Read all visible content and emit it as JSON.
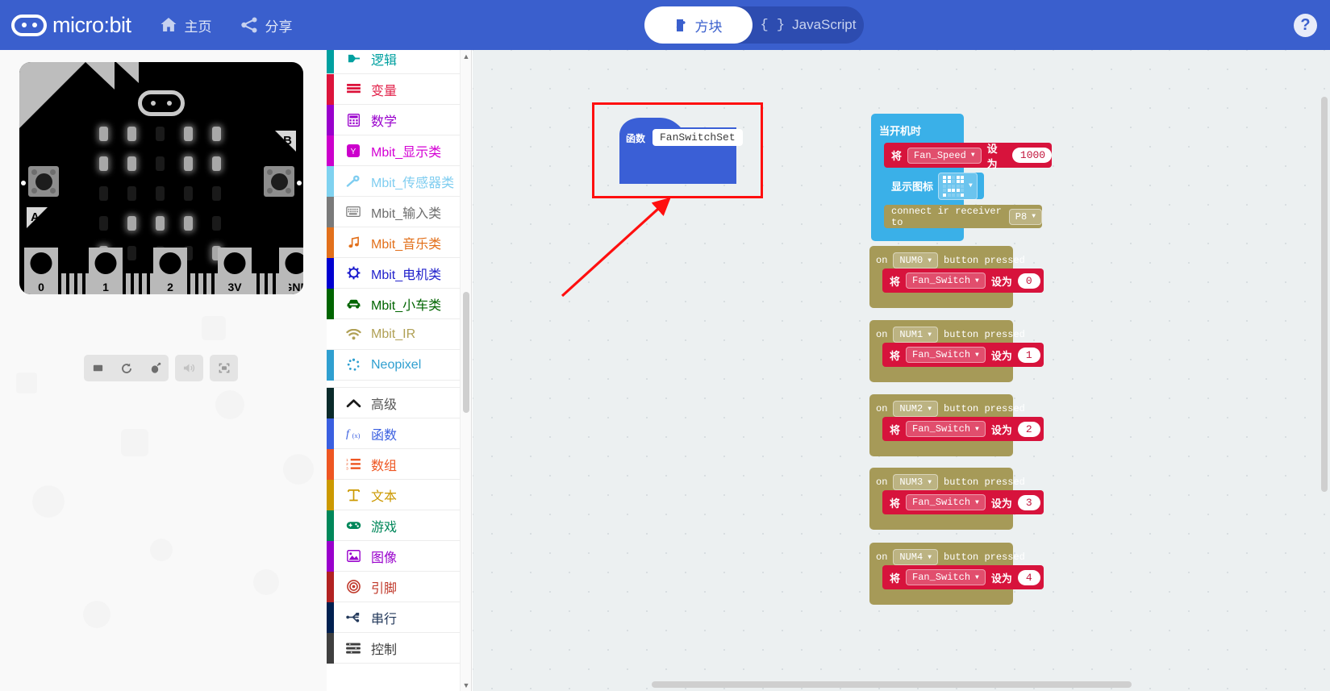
{
  "header": {
    "brand": "micro:bit",
    "home_label": "主页",
    "share_label": "分享",
    "home_icon": "home-icon",
    "share_icon": "share-icon",
    "help_icon": "question-mark-icon",
    "accent": "#3A5FCD",
    "tabs": [
      {
        "label": "方块",
        "icon": "puzzle-piece-icon",
        "active": true
      },
      {
        "label": "JavaScript",
        "icon": "curly-braces-icon",
        "active": false
      }
    ]
  },
  "simulator": {
    "board_name": "microbit-simulator",
    "button_a_label": "A",
    "button_b_label": "B",
    "pin_labels": [
      "0",
      "1",
      "2",
      "3V",
      "GND"
    ],
    "led_matrix": [
      [
        1,
        1,
        0,
        1,
        1
      ],
      [
        1,
        1,
        0,
        1,
        1
      ],
      [
        0,
        0,
        0,
        0,
        0
      ],
      [
        0,
        1,
        1,
        1,
        0
      ],
      [
        1,
        0,
        0,
        0,
        1
      ]
    ],
    "controls": [
      {
        "name": "stop-button",
        "icon": "stop-icon"
      },
      {
        "name": "restart-button",
        "icon": "restart-icon"
      },
      {
        "name": "debug-button",
        "icon": "bug-icon"
      },
      {
        "name": "mute-button",
        "icon": "speaker-icon"
      },
      {
        "name": "fullscreen-button",
        "icon": "fullscreen-icon"
      }
    ]
  },
  "toolbox": {
    "categories": [
      {
        "label": "逻辑",
        "color": "#00a0a0",
        "icon": "logic-icon",
        "text_color": "#00a0a0",
        "partial": true
      },
      {
        "label": "变量",
        "color": "#dc143c",
        "icon": "variables-icon",
        "text_color": "#e2234b"
      },
      {
        "label": "数学",
        "color": "#9900cc",
        "icon": "calculator-icon",
        "text_color": "#9900cc"
      },
      {
        "label": "Mbit_显示类",
        "color": "#cc00cc",
        "icon": "display-icon",
        "text_color": "#d400d4"
      },
      {
        "label": "Mbit_传感器类",
        "color": "#7fd2f0",
        "icon": "sensor-icon",
        "text_color": "#7fcdf0"
      },
      {
        "label": "Mbit_输入类",
        "color": "#7a7a7a",
        "icon": "keyboard-icon",
        "text_color": "#6e6e6e"
      },
      {
        "label": "Mbit_音乐类",
        "color": "#e2701b",
        "icon": "music-note-icon",
        "text_color": "#e2701b"
      },
      {
        "label": "Mbit_电机类",
        "color": "#0000d0",
        "icon": "gear-icon",
        "text_color": "#2222cc"
      },
      {
        "label": "Mbit_小车类",
        "color": "#006400",
        "icon": "car-icon",
        "text_color": "#006400"
      },
      {
        "label": "Mbit_IR",
        "color": "#b8a martin",
        "icon": "wifi-icon",
        "text_color": "#b0a055"
      },
      {
        "label": "Neopixel",
        "color": "#2f9fd0",
        "icon": "neopixel-icon",
        "text_color": "#2f9fd0"
      }
    ],
    "advanced": [
      {
        "label": "高级",
        "color": "#0a2a2a",
        "icon": "chevron-up-icon",
        "text_color": "#555555"
      },
      {
        "label": "函数",
        "color": "#3a5fe0",
        "icon": "function-icon",
        "text_color": "#3a5fe0"
      },
      {
        "label": "数组",
        "color": "#ee5622",
        "icon": "list-icon",
        "text_color": "#ee5622"
      },
      {
        "label": "文本",
        "color": "#cc9900",
        "icon": "text-icon",
        "text_color": "#cc9900"
      },
      {
        "label": "游戏",
        "color": "#00875a",
        "icon": "gamepad-icon",
        "text_color": "#00875a"
      },
      {
        "label": "图像",
        "color": "#9900cc",
        "icon": "image-icon",
        "text_color": "#9900cc"
      },
      {
        "label": "引脚",
        "color": "#b22222",
        "icon": "target-icon",
        "text_color": "#c0392b"
      },
      {
        "label": "串行",
        "color": "#002050",
        "icon": "usb-icon",
        "text_color": "#23395b"
      },
      {
        "label": "控制",
        "color": "#3f3f3f",
        "icon": "control-icon",
        "text_color": "#3f3f3f"
      }
    ],
    "scroll_up_icon": "chevron-up-icon",
    "scroll_down_icon": "chevron-down-icon"
  },
  "workspace": {
    "function_block": {
      "keyword": "函数",
      "name": "FanSwitchSet",
      "color": "#3a5fd6",
      "highlight_color": "#ff0f0f"
    },
    "annotation_arrow": {
      "name": "red-arrow",
      "color": "#ff0f0f"
    },
    "on_start": {
      "label": "当开机时",
      "color": "#3ab0e8",
      "statements": [
        {
          "type": "set-variable",
          "prefix": "将",
          "variable": "Fan_Speed",
          "middle": "设为",
          "value": "1000",
          "color": "#d7133c"
        },
        {
          "type": "show-icon",
          "label": "显示图标",
          "icon_pattern": "heart-small-icon",
          "color": "#3ab0e8"
        },
        {
          "type": "ir-connect",
          "label": "connect ir receiver to",
          "pin": "P8",
          "color": "#a69a58"
        }
      ]
    },
    "button_handlers": [
      {
        "prefix": "on",
        "button": "NUM0",
        "suffix": "button pressed",
        "color": "#a69a58",
        "body": {
          "prefix": "将",
          "variable": "Fan_Switch",
          "middle": "设为",
          "value": "0",
          "color": "#d7133c"
        }
      },
      {
        "prefix": "on",
        "button": "NUM1",
        "suffix": "button pressed",
        "color": "#a69a58",
        "body": {
          "prefix": "将",
          "variable": "Fan_Switch",
          "middle": "设为",
          "value": "1",
          "color": "#d7133c"
        }
      },
      {
        "prefix": "on",
        "button": "NUM2",
        "suffix": "button pressed",
        "color": "#a69a58",
        "body": {
          "prefix": "将",
          "variable": "Fan_Switch",
          "middle": "设为",
          "value": "2",
          "color": "#d7133c"
        }
      },
      {
        "prefix": "on",
        "button": "NUM3",
        "suffix": "button pressed",
        "color": "#a69a58",
        "body": {
          "prefix": "将",
          "variable": "Fan_Switch",
          "middle": "设为",
          "value": "3",
          "color": "#d7133c"
        }
      },
      {
        "prefix": "on",
        "button": "NUM4",
        "suffix": "button pressed",
        "color": "#a69a58",
        "body": {
          "prefix": "将",
          "variable": "Fan_Switch",
          "middle": "设为",
          "value": "4",
          "color": "#d7133c"
        }
      }
    ]
  }
}
